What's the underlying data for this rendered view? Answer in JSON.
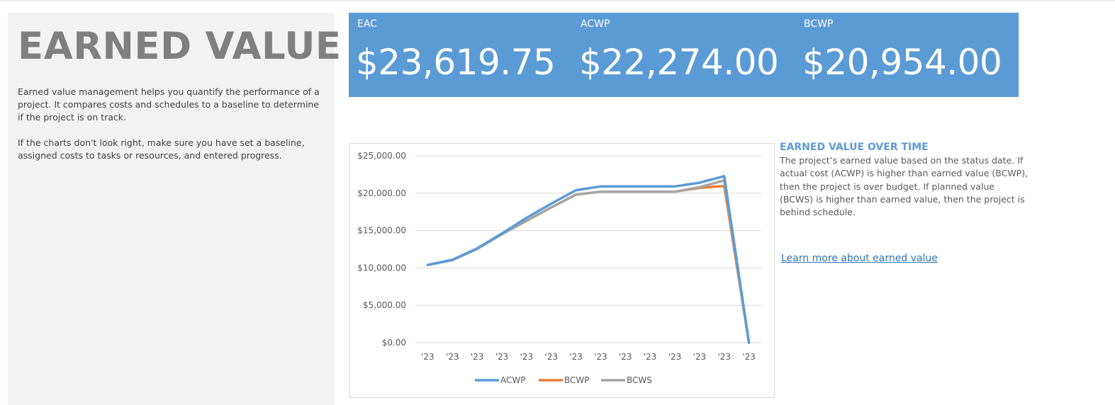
{
  "left": {
    "title": "EARNED VALUE",
    "paragraph1": "Earned value management helps you quantify the performance of a project. It compares costs and schedules to a baseline to determine if the project is on track.",
    "paragraph2": "If the charts don't look right, make sure you have set a baseline, assigned costs to tasks or resources, and entered progress."
  },
  "kpis": [
    {
      "label": "EAC",
      "value": "$23,619.75"
    },
    {
      "label": "ACWP",
      "value": "$22,274.00"
    },
    {
      "label": "BCWP",
      "value": "$20,954.00"
    }
  ],
  "side": {
    "title": "EARNED VALUE OVER TIME",
    "description": "The project’s earned value based on the status date.  If actual cost (ACWP) is higher than earned value (BCWP), then the project is over budget.  If planned value (BCWS) is higher than earned value, then the project is behind schedule.",
    "link": "Learn more about earned value"
  },
  "colors": {
    "banner": "#5b9bd5",
    "acwp": "#5b9bd5",
    "bcwp": "#ed7d31",
    "bcws": "#a5a5a5"
  },
  "chart_data": {
    "type": "line",
    "title": "",
    "xlabel": "",
    "ylabel": "",
    "categories": [
      "'23",
      "'23",
      "'23",
      "'23",
      "'23",
      "'23",
      "'23",
      "'23",
      "'23",
      "'23",
      "'23",
      "'23",
      "'23",
      "'23"
    ],
    "y_ticks": [
      "$0.00",
      "$5,000.00",
      "$10,000.00",
      "$15,000.00",
      "$20,000.00",
      "$25,000.00"
    ],
    "ylim": [
      0,
      25000
    ],
    "grid": true,
    "legend_position": "bottom",
    "series": [
      {
        "name": "ACWP",
        "color": "#5b9bd5",
        "values": [
          10400,
          11100,
          12600,
          14600,
          16700,
          18600,
          20400,
          20900,
          20900,
          20900,
          20900,
          21400,
          22274,
          0
        ]
      },
      {
        "name": "BCWP",
        "color": "#ed7d31",
        "values": [
          10400,
          11050,
          12550,
          14500,
          16300,
          18100,
          19800,
          20200,
          20200,
          20200,
          20200,
          20700,
          20954,
          0
        ]
      },
      {
        "name": "BCWS",
        "color": "#a5a5a5",
        "values": [
          10400,
          11050,
          12550,
          14500,
          16300,
          18100,
          19800,
          20200,
          20200,
          20200,
          20200,
          20800,
          21700,
          0
        ]
      }
    ]
  }
}
